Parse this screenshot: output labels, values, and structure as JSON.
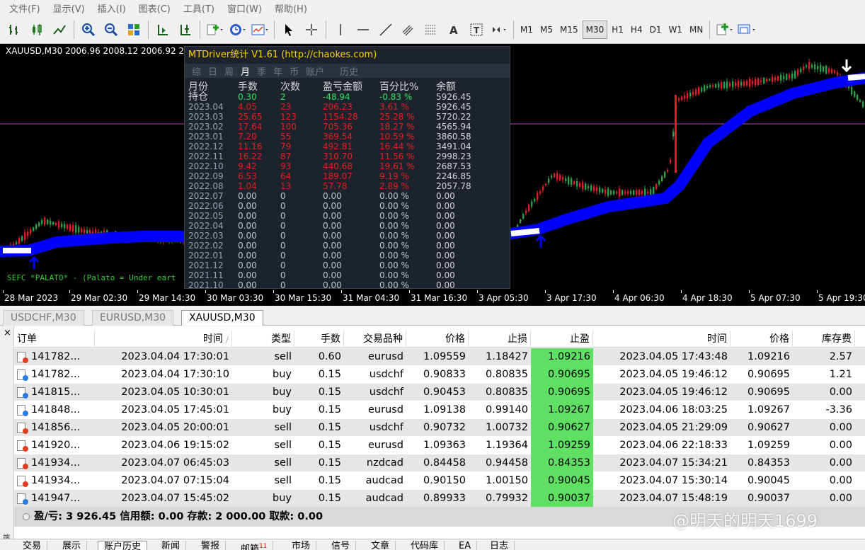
{
  "menu": [
    "文件(F)",
    "显示(V)",
    "插入(I)",
    "图表(C)",
    "工具(T)",
    "窗口(W)",
    "帮助(H)"
  ],
  "timeframes": [
    "M1",
    "M5",
    "M15",
    "M30",
    "H1",
    "H4",
    "D1",
    "W1",
    "MN"
  ],
  "active_timeframe": "M30",
  "chart": {
    "title": "XAUUSD,M30  2006.96 2008.12 2006.92 2",
    "indicator_label": "SEFC *PALATO* - (Palato = Under eart",
    "time_labels": [
      "28 Mar 2023",
      "29 Mar 02:30",
      "29 Mar 14:30",
      "30 Mar 03:30",
      "30 Mar 15:30",
      "31 Mar 04:30",
      "31 Mar 16:30",
      "3 Apr 05:30",
      "3 Apr 17:30",
      "4 Apr 06:30",
      "4 Apr 18:30",
      "5 Apr 07:30",
      "5 Apr 19:30"
    ],
    "colors": {
      "background": "#000000",
      "up": "#2ea043",
      "down": "#e02020",
      "trend": "#0000ff",
      "level": "#c040c0"
    }
  },
  "stats": {
    "title": "MTDriver统计 V1.61  (http://chaokes.com)",
    "tabs": [
      "综",
      "日",
      "周",
      "月",
      "季",
      "年",
      "币",
      "账户",
      "历史"
    ],
    "active_tab": "月",
    "headers": [
      "月份",
      "手数",
      "次数",
      "盈亏金额",
      "百分比%",
      "余额"
    ],
    "holding": {
      "label": "持仓",
      "lots": "0.30",
      "count": "2",
      "pnl": "-48.94",
      "pct": "-0.83 %",
      "balance": "5926.45"
    },
    "rows": [
      {
        "month": "2023.04",
        "lots": "4.05",
        "count": "23",
        "pnl": "206.23",
        "pct": "3.61 %",
        "balance": "5926.45",
        "profit": true
      },
      {
        "month": "2023.03",
        "lots": "25.65",
        "count": "123",
        "pnl": "1154.28",
        "pct": "25.28 %",
        "balance": "5720.22",
        "profit": true
      },
      {
        "month": "2023.02",
        "lots": "17.64",
        "count": "100",
        "pnl": "705.36",
        "pct": "18.27 %",
        "balance": "4565.94",
        "profit": true
      },
      {
        "month": "2023.01",
        "lots": "7.20",
        "count": "55",
        "pnl": "369.54",
        "pct": "10.59 %",
        "balance": "3860.58",
        "profit": true
      },
      {
        "month": "2022.12",
        "lots": "11.16",
        "count": "79",
        "pnl": "492.81",
        "pct": "16.44 %",
        "balance": "3491.04",
        "profit": true
      },
      {
        "month": "2022.11",
        "lots": "16.22",
        "count": "87",
        "pnl": "310.70",
        "pct": "11.56 %",
        "balance": "2998.23",
        "profit": true
      },
      {
        "month": "2022.10",
        "lots": "9.42",
        "count": "93",
        "pnl": "440.68",
        "pct": "19.61 %",
        "balance": "2687.53",
        "profit": true
      },
      {
        "month": "2022.09",
        "lots": "6.53",
        "count": "64",
        "pnl": "189.07",
        "pct": "9.19 %",
        "balance": "2246.85",
        "profit": true
      },
      {
        "month": "2022.08",
        "lots": "1.04",
        "count": "13",
        "pnl": "57.78",
        "pct": "2.89 %",
        "balance": "2057.78",
        "profit": true
      },
      {
        "month": "2022.07",
        "lots": "0.00",
        "count": "0",
        "pnl": "0.00",
        "pct": "0.00 %",
        "balance": "0.00",
        "profit": false
      },
      {
        "month": "2022.06",
        "lots": "0.00",
        "count": "0",
        "pnl": "0.00",
        "pct": "0.00 %",
        "balance": "0.00",
        "profit": false
      },
      {
        "month": "2022.05",
        "lots": "0.00",
        "count": "0",
        "pnl": "0.00",
        "pct": "0.00 %",
        "balance": "0.00",
        "profit": false
      },
      {
        "month": "2022.04",
        "lots": "0.00",
        "count": "0",
        "pnl": "0.00",
        "pct": "0.00 %",
        "balance": "0.00",
        "profit": false
      },
      {
        "month": "2022.03",
        "lots": "0.00",
        "count": "0",
        "pnl": "0.00",
        "pct": "0.00 %",
        "balance": "0.00",
        "profit": false
      },
      {
        "month": "2022.02",
        "lots": "0.00",
        "count": "0",
        "pnl": "0.00",
        "pct": "0.00 %",
        "balance": "0.00",
        "profit": false
      },
      {
        "month": "2022.01",
        "lots": "0.00",
        "count": "0",
        "pnl": "0.00",
        "pct": "0.00 %",
        "balance": "0.00",
        "profit": false
      },
      {
        "month": "2021.12",
        "lots": "0.00",
        "count": "0",
        "pnl": "0.00",
        "pct": "0.00 %",
        "balance": "0.00",
        "profit": false
      },
      {
        "month": "2021.11",
        "lots": "0.00",
        "count": "0",
        "pnl": "0.00",
        "pct": "0.00 %",
        "balance": "0.00",
        "profit": false
      },
      {
        "month": "2021.10",
        "lots": "0.00",
        "count": "0",
        "pnl": "0.00",
        "pct": "0.00 %",
        "balance": "0.00",
        "profit": false
      }
    ]
  },
  "chart_tabs": [
    "USDCHF,M30",
    "EURUSD,M30",
    "XAUUSD,M30"
  ],
  "active_chart_tab": "XAUUSD,M30",
  "terminal": {
    "close": "×",
    "side_label": "端",
    "columns": [
      "订单",
      "时间",
      "类型",
      "手数",
      "交易品种",
      "价格",
      "止损",
      "止盈",
      "时间",
      "价格",
      "库存费"
    ],
    "sort_indicator": "/",
    "rows": [
      {
        "order": "141782...",
        "open_time": "2023.04.04 17:30:01",
        "type": "sell",
        "lots": "0.60",
        "symbol": "eurusd",
        "open_price": "1.09559",
        "sl": "1.18427",
        "tp": "1.09216",
        "close_time": "2023.04.05 17:43:48",
        "close_price": "1.09216",
        "swap": "2.57"
      },
      {
        "order": "141782...",
        "open_time": "2023.04.04 17:30:10",
        "type": "buy",
        "lots": "0.15",
        "symbol": "usdchf",
        "open_price": "0.90833",
        "sl": "0.80835",
        "tp": "0.90695",
        "close_time": "2023.04.05 19:46:12",
        "close_price": "0.90695",
        "swap": "1.21"
      },
      {
        "order": "141815...",
        "open_time": "2023.04.05 10:30:01",
        "type": "buy",
        "lots": "0.15",
        "symbol": "usdchf",
        "open_price": "0.90453",
        "sl": "0.80835",
        "tp": "0.90695",
        "close_time": "2023.04.05 19:46:12",
        "close_price": "0.90695",
        "swap": "0.00"
      },
      {
        "order": "141848...",
        "open_time": "2023.04.05 17:45:01",
        "type": "buy",
        "lots": "0.15",
        "symbol": "eurusd",
        "open_price": "1.09138",
        "sl": "0.99140",
        "tp": "1.09267",
        "close_time": "2023.04.06 18:03:25",
        "close_price": "1.09267",
        "swap": "-3.36"
      },
      {
        "order": "141856...",
        "open_time": "2023.04.05 20:00:01",
        "type": "sell",
        "lots": "0.15",
        "symbol": "usdchf",
        "open_price": "0.90732",
        "sl": "1.00732",
        "tp": "0.90627",
        "close_time": "2023.04.05 21:29:09",
        "close_price": "0.90627",
        "swap": "0.00"
      },
      {
        "order": "141920...",
        "open_time": "2023.04.06 19:15:02",
        "type": "sell",
        "lots": "0.15",
        "symbol": "eurusd",
        "open_price": "1.09363",
        "sl": "1.19364",
        "tp": "1.09259",
        "close_time": "2023.04.06 22:18:33",
        "close_price": "1.09259",
        "swap": "0.00"
      },
      {
        "order": "141934...",
        "open_time": "2023.04.07 06:45:03",
        "type": "sell",
        "lots": "0.15",
        "symbol": "nzdcad",
        "open_price": "0.84458",
        "sl": "0.94458",
        "tp": "0.84353",
        "close_time": "2023.04.07 15:34:21",
        "close_price": "0.84353",
        "swap": "0.00"
      },
      {
        "order": "141934...",
        "open_time": "2023.04.07 07:15:04",
        "type": "sell",
        "lots": "0.15",
        "symbol": "audcad",
        "open_price": "0.90150",
        "sl": "1.00150",
        "tp": "0.90045",
        "close_time": "2023.04.07 15:30:14",
        "close_price": "0.90045",
        "swap": "0.00"
      },
      {
        "order": "141947...",
        "open_time": "2023.04.07 15:45:02",
        "type": "buy",
        "lots": "0.15",
        "symbol": "audcad",
        "open_price": "0.89933",
        "sl": "0.79932",
        "tp": "0.90037",
        "close_time": "2023.04.07 15:48:19",
        "close_price": "0.90037",
        "swap": "0.00"
      }
    ],
    "summary": "盈/亏: 3 926.45  信用额: 0.00  存款: 2 000.00  取款: 0.00"
  },
  "bottom_tabs": [
    {
      "label": "交易"
    },
    {
      "label": "展示"
    },
    {
      "label": "账户历史",
      "active": true
    },
    {
      "label": "新闻"
    },
    {
      "label": "警报"
    },
    {
      "label": "邮箱",
      "badge": "11"
    },
    {
      "label": "市场"
    },
    {
      "label": "信号"
    },
    {
      "label": "文章"
    },
    {
      "label": "代码库"
    },
    {
      "label": "EA"
    },
    {
      "label": "日志"
    }
  ],
  "watermark": "@明天的明天1699",
  "colors": {
    "sell_icon": "#e04020",
    "buy_icon": "#2a7de0",
    "tp_highlight": "#5fe063"
  }
}
